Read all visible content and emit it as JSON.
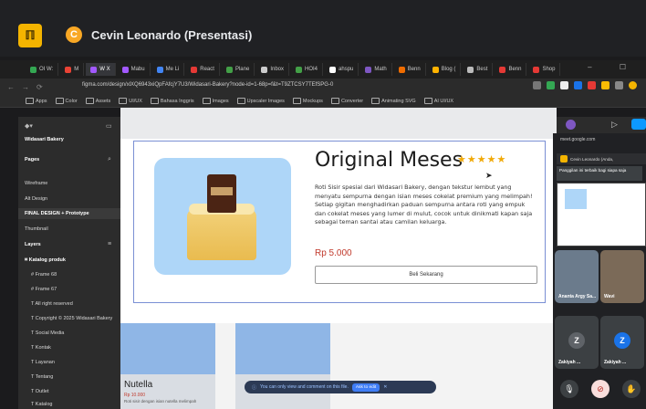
{
  "meet": {
    "logo_letter": "ℿ",
    "presenter_initial": "C",
    "presenter_title": "Cevin Leonardo (Presentasi)"
  },
  "browser": {
    "tabs": [
      "OI W:",
      "M",
      "W X",
      "Mabu",
      "Me Li",
      "React",
      "Plane",
      "Inbox",
      "HOI4",
      "ahspu",
      "Math",
      "Benn",
      "Blog (",
      "Best",
      "Benn",
      "Shop"
    ],
    "url": "figma.com/design/xlXQ6943xiQpFAfcjY7U3/Widasari-Bakery?node-id=1-68p=f&t=T9ZTCSY7TEfSPG-0",
    "bookmarks": [
      "Apps",
      "Color",
      "Assets",
      "UI/UX",
      "Bahasa Inggris",
      "Images",
      "Upscaler Images",
      "Mockups",
      "Converter",
      "Animating SVG",
      "AI UI/UX"
    ]
  },
  "figma": {
    "file_name": "Widasari Bakery",
    "pages_label": "Pages",
    "pages": [
      "Wireframe",
      "Alt Design",
      "FINAL DESIGN + Prototype",
      "Thumbnail"
    ],
    "layers_label": "Layers",
    "layers": [
      "Katalog produk",
      "Frame 68",
      "Frame 67",
      "All right reserved",
      "Copyright © 2025 Widasari Bakery",
      "Social Media",
      "Kontak",
      "Layanan",
      "Tentang",
      "Outlet",
      "Katalog"
    ],
    "toast_text": "You can only view and comment on this file.",
    "toast_button": "Ask to edit"
  },
  "product": {
    "title": "Original Meses",
    "stars": "★★★★★",
    "description": "Roti Sisir spesial dari Widasari Bakery, dengan tekstur lembut yang menyatu sempurna dengan isian meses cokelat premium yang melimpah! Setiap gigitan menghadirkan paduan sempurna antara roti yang empuk dan cokelat meses yang lumer di mulut, cocok untuk dinikmati kapan saja sebagai teman santai atau camilan keluarga.",
    "price": "Rp 5.000",
    "buy_button": "Beli Sekarang"
  },
  "catalog": {
    "card_name": "Nutella",
    "card_price": "Rp 10.000",
    "card_desc": "Roti sisir dengan isian nutella melimpah"
  },
  "meet_side": {
    "domain": "meet.google.com",
    "mini_title": "Cevin Leonardo (Anda,",
    "tooltip": "Panggilan ini terbaik bagi siapa saja",
    "participants": [
      "Ananta Argy Sa...",
      "Wavi",
      "Zakiyah ...",
      "Zakiyah ..."
    ],
    "avatar_initial": "Z"
  }
}
